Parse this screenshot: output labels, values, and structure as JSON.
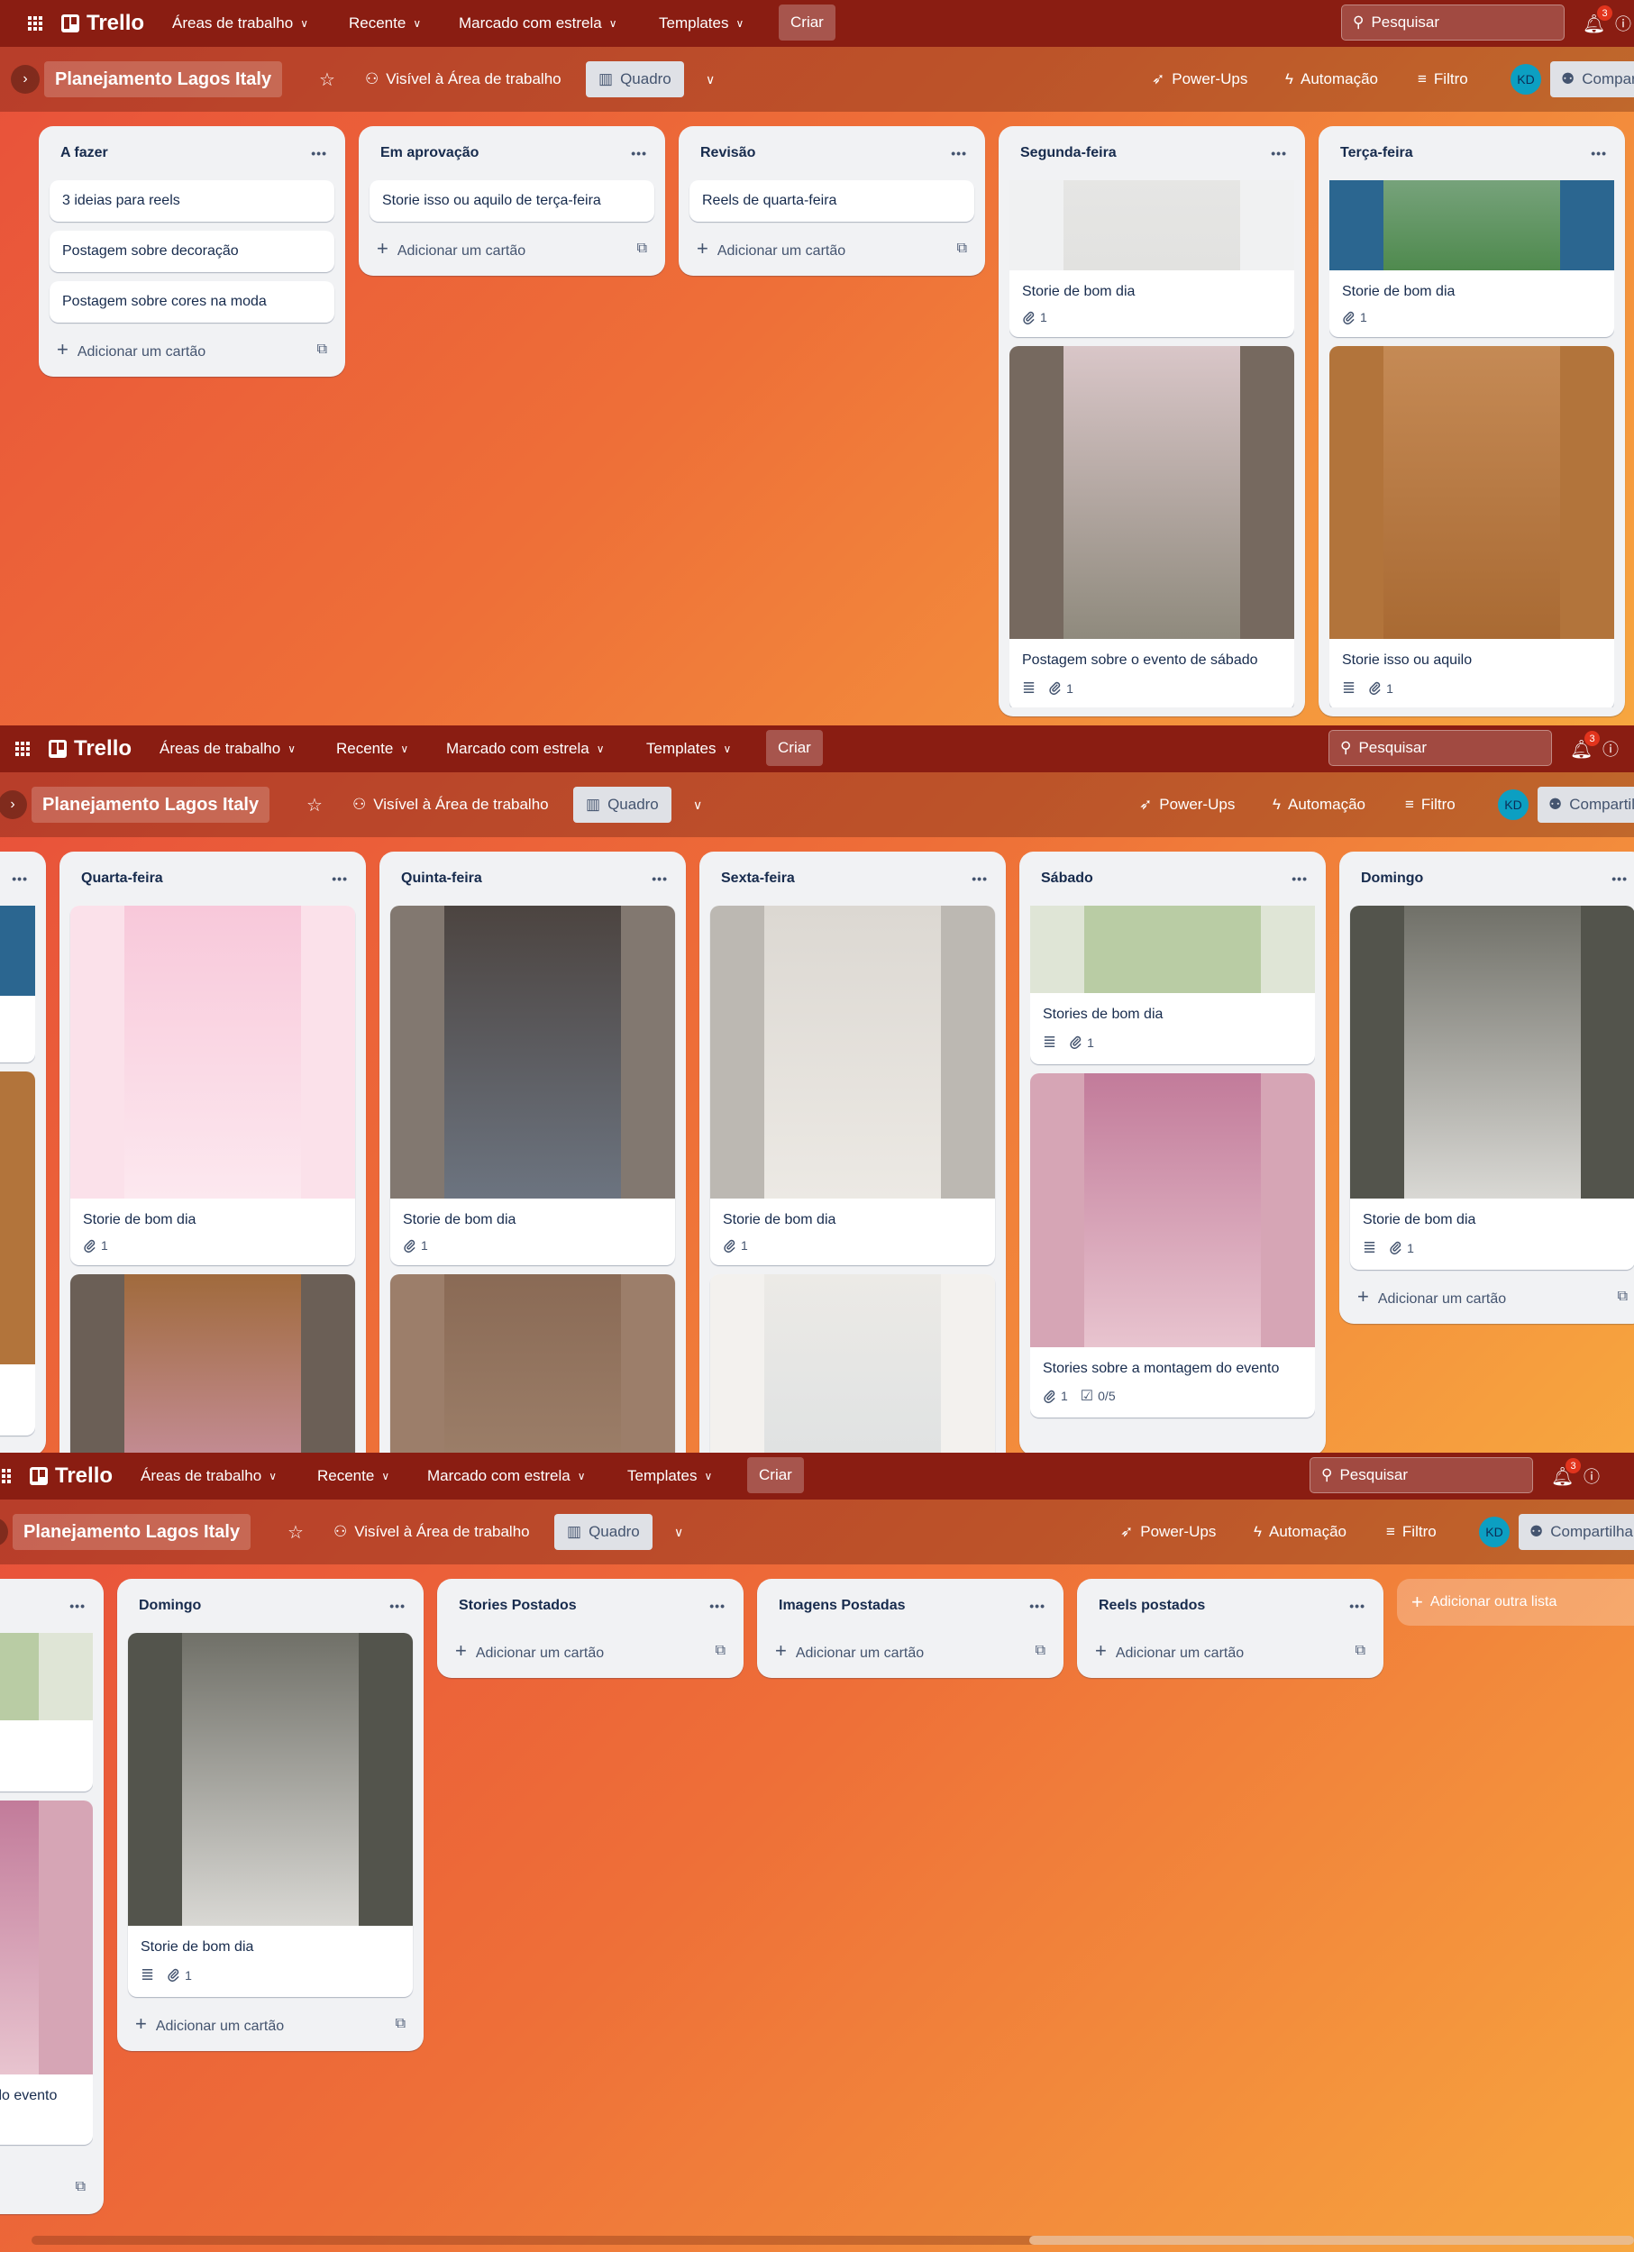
{
  "nav": {
    "app_name": "Trello",
    "items": [
      "Áreas de trabalho",
      "Recente",
      "Marcado com estrela",
      "Templates"
    ],
    "create_label": "Criar",
    "search_placeholder": "Pesquisar",
    "notifications_count": "3",
    "colors": {
      "nav_bg": "#8a1d12",
      "board_gradient": [
        "#e8503a",
        "#f7a63f"
      ]
    }
  },
  "board": {
    "title": "Planejamento Lagos Italy",
    "visibility": "Visível à Área de trabalho",
    "view": "Quadro",
    "power_ups": "Power-Ups",
    "automation": "Automação",
    "filter": "Filtro",
    "avatar_initials": "KD",
    "share": "Compartilhar",
    "add_card_label": "Adicionar um cartão",
    "add_list_label": "Adicionar outra lista"
  },
  "lists": [
    {
      "title": "A fazer",
      "cards": [
        {
          "title": "3 ideias para reels"
        },
        {
          "title": "Postagem sobre decoração"
        },
        {
          "title": "Postagem sobre cores na moda"
        }
      ],
      "add": true
    },
    {
      "title": "Em aprovação",
      "cards": [
        {
          "title": "Storie isso ou aquilo de terça-feira"
        }
      ],
      "add": true
    },
    {
      "title": "Revisão",
      "cards": [
        {
          "title": "Reels de quarta-feira"
        }
      ],
      "add": true
    },
    {
      "title": "Segunda-feira",
      "cards": [
        {
          "title": "Storie de bom dia",
          "cover": {
            "bg": "#f0f1f2",
            "img": [
              "#eeeeee",
              "#e2e2e0"
            ]
          },
          "attachments": "1"
        },
        {
          "title": "Postagem sobre o evento de sábado",
          "cover": {
            "bg": "#76695f",
            "img": [
              "#d9c6c8",
              "#8f8a7d"
            ]
          },
          "description": true,
          "attachments": "1"
        }
      ]
    },
    {
      "title": "Terça-feira",
      "cards": [
        {
          "title": "Storie de bom dia",
          "cover": {
            "bg": "#2b6690",
            "img": [
              "#cfd9e0",
              "#4f8a4e"
            ]
          },
          "attachments": "1"
        },
        {
          "title": "Storie isso ou aquilo",
          "cover": {
            "bg": "#b2743b",
            "img": [
              "#c58a55",
              "#a96a33"
            ]
          },
          "description": true,
          "attachments": "1"
        }
      ]
    },
    {
      "title": "Quarta-feira",
      "cards": [
        {
          "title": "Storie de bom dia",
          "cover": {
            "bg": "#fbe1ea",
            "img": [
              "#f8c8da",
              "#fce8ef"
            ]
          },
          "attachments": "1"
        },
        {
          "cover": {
            "bg": "#6b5f56",
            "img": [
              "#a06a3c",
              "#d8a0c8"
            ]
          }
        }
      ]
    },
    {
      "title": "Quinta-feira",
      "cards": [
        {
          "title": "Storie de bom dia",
          "cover": {
            "bg": "#827870",
            "img": [
              "#4c4440",
              "#6c7480"
            ]
          },
          "attachments": "1"
        },
        {
          "cover": {
            "bg": "#9c7e6a",
            "img": [
              "#8a6a55",
              "#a68a74"
            ]
          }
        }
      ]
    },
    {
      "title": "Sexta-feira",
      "cards": [
        {
          "title": "Storie de bom dia",
          "cover": {
            "bg": "#bcb8b2",
            "img": [
              "#dcd8d2",
              "#ece9e4"
            ]
          },
          "attachments": "1"
        },
        {
          "cover": {
            "bg": "#f3f1ee",
            "img": [
              "#eceae6",
              "#d8dde0"
            ]
          }
        }
      ]
    },
    {
      "title": "Sábado",
      "cards": [
        {
          "title": "Stories de bom dia",
          "cover": {
            "bg": "#dfe5d6",
            "img": [
              "#b9cca4",
              "#b9cca4"
            ]
          },
          "description": true,
          "attachments": "1"
        },
        {
          "title": "Stories sobre a montagem do evento",
          "cover": {
            "bg": "#d6a5b5",
            "img": [
              "#c27b9a",
              "#e8c4cf"
            ]
          },
          "attachments": "1",
          "checklist": "0/5"
        }
      ]
    },
    {
      "title": "Domingo",
      "cards": [
        {
          "title": "Storie de bom dia",
          "cover": {
            "bg": "#53544c",
            "img": [
              "#707068",
              "#d9d8d4"
            ]
          },
          "description": true,
          "attachments": "1"
        }
      ],
      "add": true
    },
    {
      "title": "Stories Postados",
      "cards": [],
      "add": true
    },
    {
      "title": "Imagens Postadas",
      "cards": [],
      "add": true
    },
    {
      "title": "Reels postados",
      "cards": [],
      "add": true
    }
  ]
}
